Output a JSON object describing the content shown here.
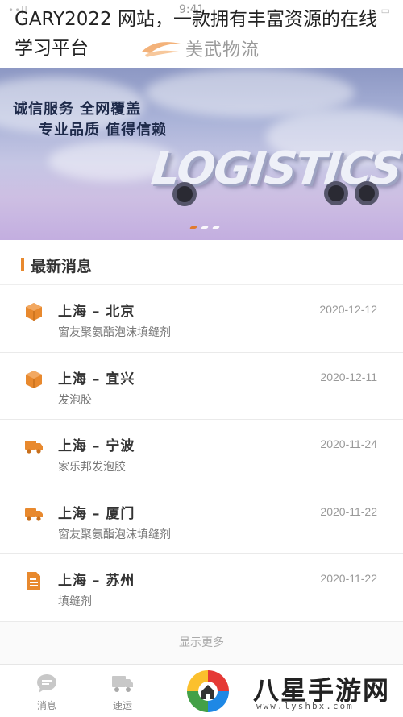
{
  "overlay_title": "GARY2022 网站，一款拥有丰富资源的在线学习平台",
  "status_bar": {
    "time": "9:41",
    "signal": "••ll",
    "battery": "▭"
  },
  "brand": {
    "name": "美武物流",
    "accent": "#f0a060"
  },
  "banner": {
    "line1": "诚信服务  全网覆盖",
    "line2": "专业品质  值得信赖",
    "logo_text": "LOGISTICS",
    "slides": 3,
    "active_slide": 1
  },
  "news": {
    "title": "最新消息",
    "accent": "#e8892e",
    "items": [
      {
        "route": "上海 – 北京",
        "desc": "窗友聚氨酯泡沫填缝剂",
        "date": "2020-12-12",
        "icon": "package-icon"
      },
      {
        "route": "上海 – 宜兴",
        "desc": "发泡胶",
        "date": "2020-12-11",
        "icon": "package-icon"
      },
      {
        "route": "上海 – 宁波",
        "desc": "家乐邦发泡胶",
        "date": "2020-11-24",
        "icon": "truck-icon"
      },
      {
        "route": "上海 – 厦门",
        "desc": "窗友聚氨酯泡沫填缝剂",
        "date": "2020-11-22",
        "icon": "truck-icon"
      },
      {
        "route": "上海 – 苏州",
        "desc": "填缝剂",
        "date": "2020-11-22",
        "icon": "document-icon"
      }
    ],
    "more_label": "显示更多"
  },
  "tabbar": {
    "items": [
      {
        "label": "消息",
        "icon": "message-icon"
      },
      {
        "label": "速运",
        "icon": "truck-icon"
      }
    ]
  },
  "watermark": {
    "text": "八星手游网",
    "url": "www.lyshbx.com"
  }
}
